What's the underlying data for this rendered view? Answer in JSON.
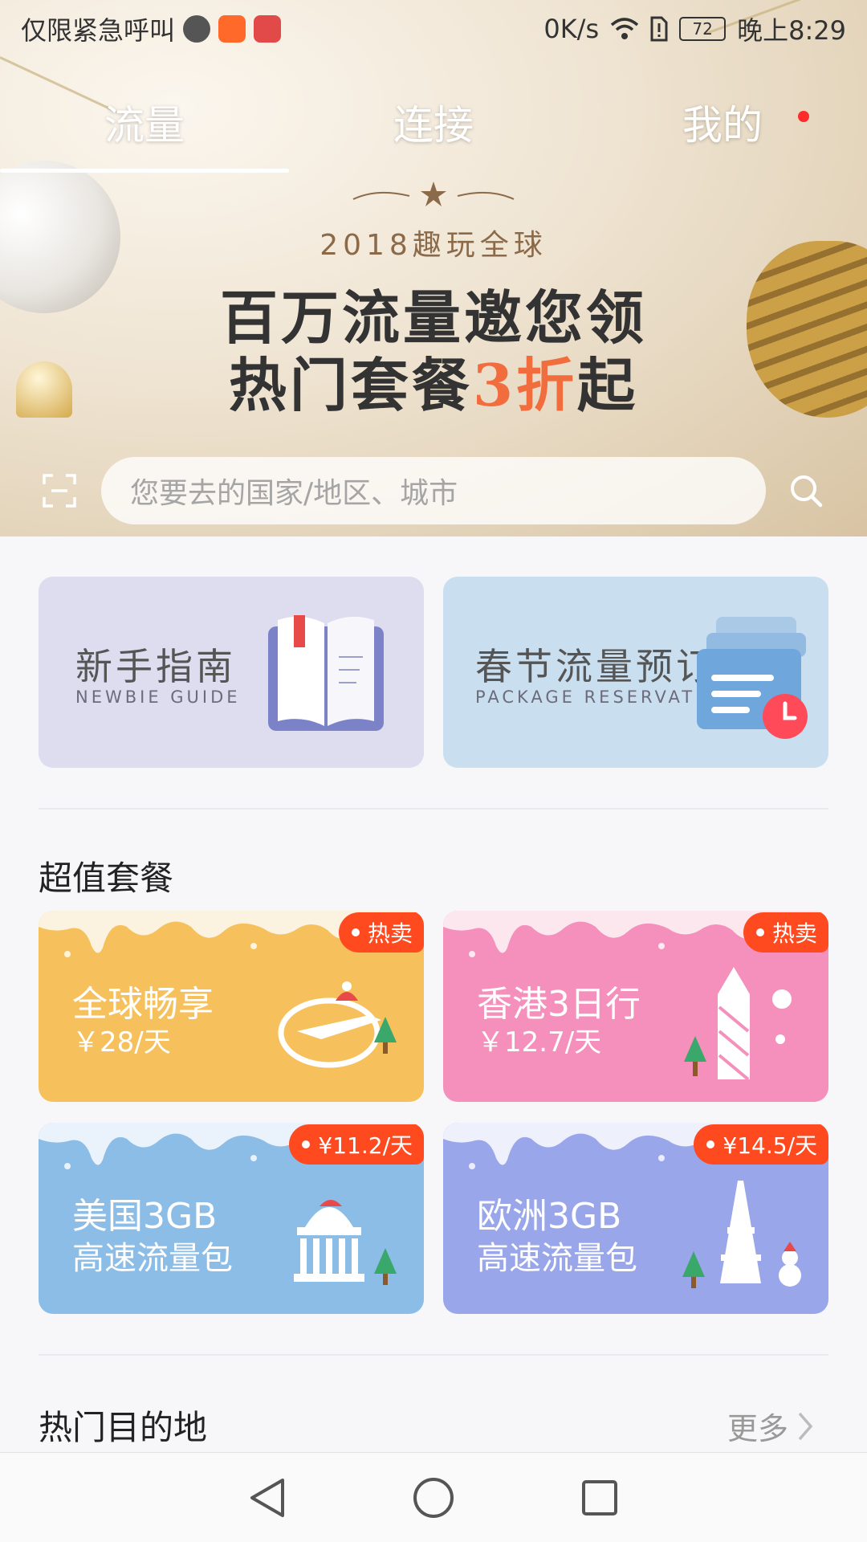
{
  "status_bar": {
    "carrier": "仅限紧急呼叫",
    "net_speed": "0K/s",
    "battery": "72",
    "time": "晚上8:29"
  },
  "tabs": [
    {
      "label": "流量",
      "active": true
    },
    {
      "label": "连接",
      "active": false
    },
    {
      "label": "我的",
      "active": false,
      "badge": true
    }
  ],
  "banner": {
    "year_line": "2018趣玩全球",
    "line1": "百万流量邀您领",
    "line2_prefix": "热门套餐",
    "line2_highlight": "3折",
    "line2_suffix": "起"
  },
  "search": {
    "placeholder": "您要去的国家/地区、城市"
  },
  "quick_links": [
    {
      "title": "新手指南",
      "subtitle": "NEWBIE GUIDE",
      "color": "#dedcef"
    },
    {
      "title": "春节流量预订",
      "subtitle": "PACKAGE RESERVATION",
      "color": "#c9dff0"
    }
  ],
  "sections": {
    "packages_title": "超值套餐",
    "destinations_title": "热门目的地",
    "more_label": "更多"
  },
  "packages": [
    {
      "name": "全球畅享",
      "price": "￥28/天",
      "tag": "热卖",
      "color": "#f6c15c",
      "icon": "plane-globe-icon"
    },
    {
      "name": "香港3日行",
      "price": "￥12.7/天",
      "tag": "热卖",
      "color": "#f490bb",
      "icon": "hk-tower-icon"
    },
    {
      "name": "美国3GB",
      "line2": "高速流量包",
      "tag": "¥11.2/天",
      "color": "#8cbde6",
      "icon": "capitol-icon"
    },
    {
      "name": "欧洲3GB",
      "line2": "高速流量包",
      "tag": "¥14.5/天",
      "color": "#9aa6ea",
      "icon": "eiffel-tower-icon"
    }
  ],
  "colors": {
    "accent_orange": "#f26d3d",
    "tag_red": "#ff4a1f",
    "badge_red": "#ff2a2a"
  }
}
